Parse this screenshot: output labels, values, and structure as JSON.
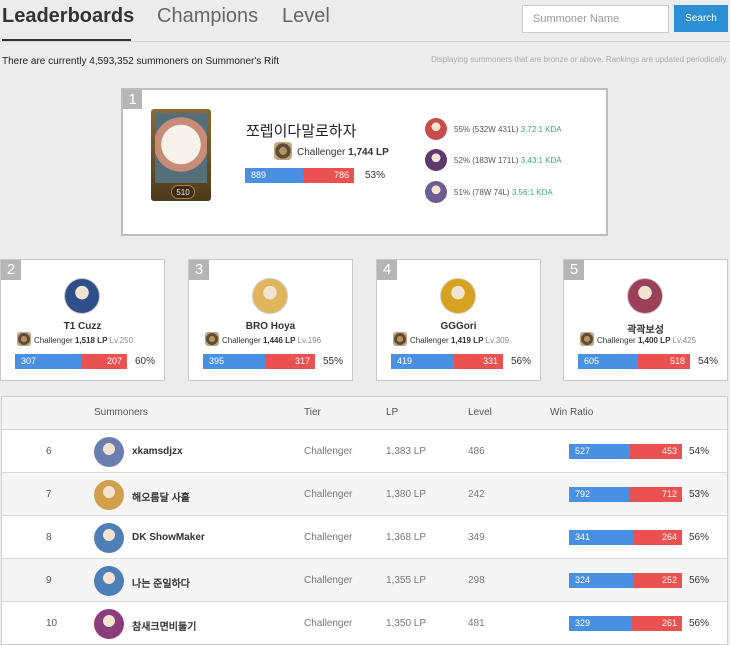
{
  "nav": {
    "tabs": [
      "Leaderboards",
      "Champions",
      "Level"
    ],
    "search_placeholder": "Summoner Name",
    "search_button": "Search"
  },
  "info": {
    "left": "There are currently 4,593,352 summoners on Summoner's Rift",
    "right": "Displaying summoners that are bronze or above. Rankings are updated periodically."
  },
  "first": {
    "rank": "1",
    "level": "510",
    "name": "쪼렙이다말로하자",
    "tier": "Challenger",
    "lp": "1,744 LP",
    "wins": "889",
    "losses": "786",
    "win_fraction": 0.53,
    "pct": "53%",
    "champions": [
      {
        "icon": "champion-portrait-icon",
        "color": "#c94b4b",
        "stats": "55% (532W 431L)",
        "kda": "3.72:1 KDA"
      },
      {
        "icon": "champion-portrait-icon",
        "color": "#5d3a6b",
        "stats": "52% (183W 171L)",
        "kda": "3.43:1 KDA"
      },
      {
        "icon": "champion-portrait-icon",
        "color": "#6d5c8f",
        "stats": "51% (78W 74L)",
        "kda": "3.56:1 KDA"
      }
    ]
  },
  "top": [
    {
      "rank": "2",
      "name": "T1 Cuzz",
      "tier": "Challenger",
      "lp": "1,518 LP",
      "lv": "Lv.250",
      "wins": "307",
      "losses": "207",
      "win_fraction": 0.597,
      "pct": "60%",
      "color": "#2e4f8a"
    },
    {
      "rank": "3",
      "name": "BRO Hoya",
      "tier": "Challenger",
      "lp": "1,446 LP",
      "lv": "Lv.196",
      "wins": "395",
      "losses": "317",
      "win_fraction": 0.555,
      "pct": "55%",
      "color": "#e0b65c"
    },
    {
      "rank": "4",
      "name": "GGGori",
      "tier": "Challenger",
      "lp": "1,419 LP",
      "lv": "Lv.309",
      "wins": "419",
      "losses": "331",
      "win_fraction": 0.559,
      "pct": "56%",
      "color": "#d6a21f"
    },
    {
      "rank": "5",
      "name": "곽곽보성",
      "tier": "Challenger",
      "lp": "1,400 LP",
      "lv": "Lv.425",
      "wins": "605",
      "losses": "518",
      "win_fraction": 0.539,
      "pct": "54%",
      "color": "#9b3f5a"
    }
  ],
  "table": {
    "headers": [
      "Summoners",
      "Tier",
      "LP",
      "Level",
      "Win Ratio"
    ],
    "rows": [
      {
        "rank": "6",
        "name": "xkamsdjzx",
        "tier": "Challenger",
        "lp": "1,383 LP",
        "level": "486",
        "wins": "527",
        "losses": "453",
        "win_fraction": 0.538,
        "pct": "54%",
        "color": "#6a7fb0"
      },
      {
        "rank": "7",
        "name": "해오름달 사흘",
        "tier": "Challenger",
        "lp": "1,380 LP",
        "level": "242",
        "wins": "792",
        "losses": "712",
        "win_fraction": 0.527,
        "pct": "53%",
        "color": "#d2a04c"
      },
      {
        "rank": "8",
        "name": "DK ShowMaker",
        "tier": "Challenger",
        "lp": "1,368 LP",
        "level": "349",
        "wins": "341",
        "losses": "264",
        "win_fraction": 0.564,
        "pct": "56%",
        "color": "#4f7fb8"
      },
      {
        "rank": "9",
        "name": "나는 준일하다",
        "tier": "Challenger",
        "lp": "1,355 LP",
        "level": "298",
        "wins": "324",
        "losses": "252",
        "win_fraction": 0.563,
        "pct": "56%",
        "color": "#4f7fb8"
      },
      {
        "rank": "10",
        "name": "참새크면비둘기",
        "tier": "Challenger",
        "lp": "1,350 LP",
        "level": "481",
        "wins": "329",
        "losses": "261",
        "win_fraction": 0.558,
        "pct": "56%",
        "color": "#8a3d7a"
      }
    ]
  }
}
